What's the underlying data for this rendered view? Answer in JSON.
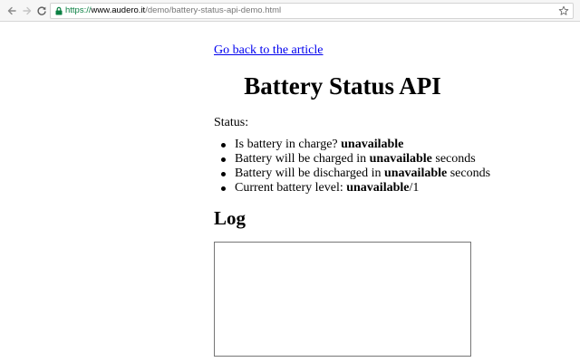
{
  "browser": {
    "url_scheme": "https://",
    "url_host": "www.audero.it",
    "url_path": "/demo/battery-status-api-demo.html",
    "icons": [
      "back-icon",
      "forward-icon",
      "reload-icon",
      "lock-icon",
      "star-icon"
    ],
    "secure_color": "#0b8043"
  },
  "page": {
    "back_link": "Go back to the article",
    "title": "Battery Status API",
    "status_label": "Status:",
    "items": [
      {
        "prefix": "Is battery in charge? ",
        "value": "unavailable",
        "suffix": ""
      },
      {
        "prefix": "Battery will be charged in ",
        "value": "unavailable",
        "suffix": " seconds"
      },
      {
        "prefix": "Battery will be discharged in ",
        "value": "unavailable",
        "suffix": " seconds"
      },
      {
        "prefix": "Current battery level: ",
        "value": "unavailable",
        "suffix": "/1"
      }
    ],
    "log_heading": "Log",
    "log_content": "",
    "link_color": "#0000ee"
  }
}
